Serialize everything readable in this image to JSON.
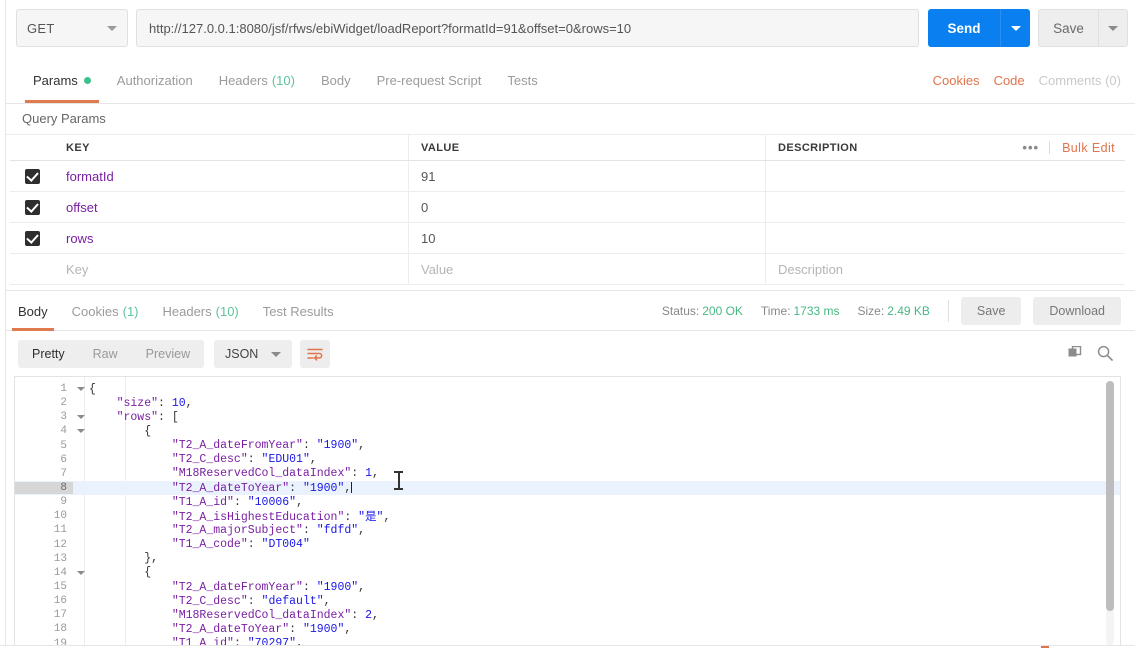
{
  "request": {
    "method": "GET",
    "url": "http://127.0.0.1:8080/jsf/rfws/ebiWidget/loadReport?formatId=91&offset=0&rows=10",
    "send_label": "Send",
    "save_label": "Save"
  },
  "request_tabs": [
    {
      "label": "Params",
      "active": true,
      "dot": true
    },
    {
      "label": "Authorization",
      "active": false
    },
    {
      "label": "Headers",
      "count": "(10)",
      "active": false
    },
    {
      "label": "Body",
      "active": false
    },
    {
      "label": "Pre-request Script",
      "active": false
    },
    {
      "label": "Tests",
      "active": false
    }
  ],
  "request_links": [
    {
      "label": "Cookies",
      "muted": false
    },
    {
      "label": "Code",
      "muted": false
    },
    {
      "label": "Comments (0)",
      "muted": true
    }
  ],
  "query_params": {
    "title": "Query Params",
    "columns": [
      "KEY",
      "VALUE",
      "DESCRIPTION"
    ],
    "more_label": "•••",
    "bulk_edit_label": "Bulk Edit",
    "rows": [
      {
        "checked": true,
        "key": "formatId",
        "value": "91",
        "description": ""
      },
      {
        "checked": true,
        "key": "offset",
        "value": "0",
        "description": ""
      },
      {
        "checked": true,
        "key": "rows",
        "value": "10",
        "description": ""
      }
    ],
    "placeholder_row": {
      "key": "Key",
      "value": "Value",
      "description": "Description"
    }
  },
  "response_tabs": [
    {
      "label": "Body",
      "active": true
    },
    {
      "label": "Cookies",
      "count": "(1)",
      "active": false
    },
    {
      "label": "Headers",
      "count": "(10)",
      "active": false
    },
    {
      "label": "Test Results",
      "active": false
    }
  ],
  "response_meta": {
    "status_label": "Status:",
    "status_value": "200 OK",
    "time_label": "Time:",
    "time_value": "1733 ms",
    "size_label": "Size:",
    "size_value": "2.49 KB",
    "save_label": "Save",
    "download_label": "Download"
  },
  "body_toolbar": {
    "views": [
      {
        "label": "Pretty",
        "active": true
      },
      {
        "label": "Raw",
        "active": false
      },
      {
        "label": "Preview",
        "active": false
      }
    ],
    "format": "JSON",
    "wrap_icon": "word-wrap-icon",
    "copy_icon": "copy-icon",
    "search_icon": "search-icon"
  },
  "colors": {
    "accent": "#e07b50",
    "send_blue": "#0a7ff0",
    "status_green": "#48b884",
    "json_key": "#7a1fa2",
    "json_value": "#1a16e8",
    "active_line": "#e9f2fd"
  },
  "code_lines": [
    {
      "n": 1,
      "fold": true,
      "indent": 0,
      "active": false,
      "tokens": [
        {
          "t": "p",
          "v": "{"
        }
      ]
    },
    {
      "n": 2,
      "fold": false,
      "indent": 0,
      "active": false,
      "tokens": [
        {
          "t": "k",
          "v": "    \"size\""
        },
        {
          "t": "p",
          "v": ": "
        },
        {
          "t": "n",
          "v": "10"
        },
        {
          "t": "p",
          "v": ","
        }
      ]
    },
    {
      "n": 3,
      "fold": true,
      "indent": 0,
      "active": false,
      "tokens": [
        {
          "t": "k",
          "v": "    \"rows\""
        },
        {
          "t": "p",
          "v": ": ["
        }
      ]
    },
    {
      "n": 4,
      "fold": true,
      "indent": 0,
      "active": false,
      "tokens": [
        {
          "t": "p",
          "v": "        {"
        }
      ]
    },
    {
      "n": 5,
      "fold": false,
      "indent": 0,
      "active": false,
      "tokens": [
        {
          "t": "k",
          "v": "            \"T2_A_dateFromYear\""
        },
        {
          "t": "p",
          "v": ": "
        },
        {
          "t": "s",
          "v": "\"1900\""
        },
        {
          "t": "p",
          "v": ","
        }
      ]
    },
    {
      "n": 6,
      "fold": false,
      "indent": 0,
      "active": false,
      "tokens": [
        {
          "t": "k",
          "v": "            \"T2_C_desc\""
        },
        {
          "t": "p",
          "v": ": "
        },
        {
          "t": "s",
          "v": "\"EDU01\""
        },
        {
          "t": "p",
          "v": ","
        }
      ]
    },
    {
      "n": 7,
      "fold": false,
      "indent": 0,
      "active": false,
      "tokens": [
        {
          "t": "k",
          "v": "            \"M18ReservedCol_dataIndex\""
        },
        {
          "t": "p",
          "v": ": "
        },
        {
          "t": "n",
          "v": "1"
        },
        {
          "t": "p",
          "v": ","
        }
      ]
    },
    {
      "n": 8,
      "fold": false,
      "indent": 0,
      "active": true,
      "caret": true,
      "tokens": [
        {
          "t": "k",
          "v": "            \"T2_A_dateToYear\""
        },
        {
          "t": "p",
          "v": ": "
        },
        {
          "t": "s",
          "v": "\"1900\""
        },
        {
          "t": "p",
          "v": ","
        }
      ]
    },
    {
      "n": 9,
      "fold": false,
      "indent": 0,
      "active": false,
      "tokens": [
        {
          "t": "k",
          "v": "            \"T1_A_id\""
        },
        {
          "t": "p",
          "v": ": "
        },
        {
          "t": "s",
          "v": "\"10006\""
        },
        {
          "t": "p",
          "v": ","
        }
      ]
    },
    {
      "n": 10,
      "fold": false,
      "indent": 0,
      "active": false,
      "tokens": [
        {
          "t": "k",
          "v": "            \"T2_A_isHighestEducation\""
        },
        {
          "t": "p",
          "v": ": "
        },
        {
          "t": "s",
          "v": "\"是\""
        },
        {
          "t": "p",
          "v": ","
        }
      ]
    },
    {
      "n": 11,
      "fold": false,
      "indent": 0,
      "active": false,
      "tokens": [
        {
          "t": "k",
          "v": "            \"T2_A_majorSubject\""
        },
        {
          "t": "p",
          "v": ": "
        },
        {
          "t": "s",
          "v": "\"fdfd\""
        },
        {
          "t": "p",
          "v": ","
        }
      ]
    },
    {
      "n": 12,
      "fold": false,
      "indent": 0,
      "active": false,
      "tokens": [
        {
          "t": "k",
          "v": "            \"T1_A_code\""
        },
        {
          "t": "p",
          "v": ": "
        },
        {
          "t": "s",
          "v": "\"DT004\""
        }
      ]
    },
    {
      "n": 13,
      "fold": false,
      "indent": 0,
      "active": false,
      "tokens": [
        {
          "t": "p",
          "v": "        },"
        }
      ]
    },
    {
      "n": 14,
      "fold": true,
      "indent": 0,
      "active": false,
      "tokens": [
        {
          "t": "p",
          "v": "        {"
        }
      ]
    },
    {
      "n": 15,
      "fold": false,
      "indent": 0,
      "active": false,
      "tokens": [
        {
          "t": "k",
          "v": "            \"T2_A_dateFromYear\""
        },
        {
          "t": "p",
          "v": ": "
        },
        {
          "t": "s",
          "v": "\"1900\""
        },
        {
          "t": "p",
          "v": ","
        }
      ]
    },
    {
      "n": 16,
      "fold": false,
      "indent": 0,
      "active": false,
      "tokens": [
        {
          "t": "k",
          "v": "            \"T2_C_desc\""
        },
        {
          "t": "p",
          "v": ": "
        },
        {
          "t": "s",
          "v": "\"default\""
        },
        {
          "t": "p",
          "v": ","
        }
      ]
    },
    {
      "n": 17,
      "fold": false,
      "indent": 0,
      "active": false,
      "tokens": [
        {
          "t": "k",
          "v": "            \"M18ReservedCol_dataIndex\""
        },
        {
          "t": "p",
          "v": ": "
        },
        {
          "t": "n",
          "v": "2"
        },
        {
          "t": "p",
          "v": ","
        }
      ]
    },
    {
      "n": 18,
      "fold": false,
      "indent": 0,
      "active": false,
      "tokens": [
        {
          "t": "k",
          "v": "            \"T2_A_dateToYear\""
        },
        {
          "t": "p",
          "v": ": "
        },
        {
          "t": "s",
          "v": "\"1900\""
        },
        {
          "t": "p",
          "v": ","
        }
      ]
    },
    {
      "n": 19,
      "fold": false,
      "indent": 0,
      "active": false,
      "tokens": [
        {
          "t": "k",
          "v": "            \"T1_A_id\""
        },
        {
          "t": "p",
          "v": ": "
        },
        {
          "t": "s",
          "v": "\"70297\""
        },
        {
          "t": "p",
          "v": ","
        }
      ]
    }
  ]
}
